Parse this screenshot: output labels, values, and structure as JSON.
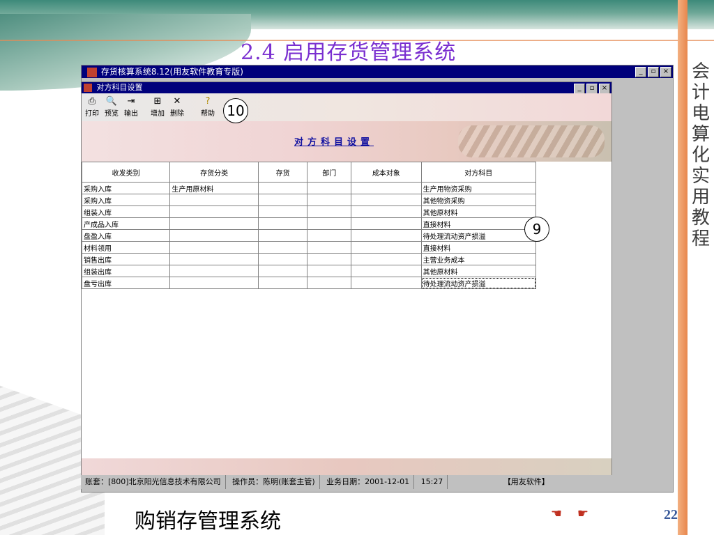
{
  "slide": {
    "title": "2.4  启用存货管理系统",
    "side_title": "会计电算化实用教程",
    "bottom_title": "购销存管理系统",
    "page_number": "22"
  },
  "outer_window": {
    "title": "存货核算系统8.12(用友软件教育专版)"
  },
  "inner_window": {
    "title": "对方科目设置"
  },
  "toolbar": {
    "print": "打印",
    "preview": "预览",
    "export": "输出",
    "add": "增加",
    "delete": "删除",
    "help": "帮助"
  },
  "callouts": {
    "a": "10",
    "b": "9"
  },
  "banner": {
    "title": "对方科目设置"
  },
  "table": {
    "headers": [
      "收发类别",
      "存货分类",
      "存货",
      "部门",
      "成本对象",
      "对方科目"
    ],
    "rows": [
      [
        "采购入库",
        "生产用原材料",
        "",
        "",
        "",
        "生产用物资采购"
      ],
      [
        "采购入库",
        "",
        "",
        "",
        "",
        "其他物资采购"
      ],
      [
        "组装入库",
        "",
        "",
        "",
        "",
        "其他原材料"
      ],
      [
        "产成品入库",
        "",
        "",
        "",
        "",
        "直接材料"
      ],
      [
        "盘盈入库",
        "",
        "",
        "",
        "",
        "待处理流动资产损溢"
      ],
      [
        "材料领用",
        "",
        "",
        "",
        "",
        "直接材料"
      ],
      [
        "销售出库",
        "",
        "",
        "",
        "",
        "主营业务成本"
      ],
      [
        "组装出库",
        "",
        "",
        "",
        "",
        "其他原材料"
      ],
      [
        "盘亏出库",
        "",
        "",
        "",
        "",
        "待处理流动资产损溢"
      ]
    ]
  },
  "statusbar": {
    "account": "账套：[800]北京阳光信息技术有限公司",
    "operator": "操作员：陈明(账套主管)",
    "date": "业务日期：2001-12-01",
    "time": "15:27",
    "brand": "【用友软件】"
  }
}
